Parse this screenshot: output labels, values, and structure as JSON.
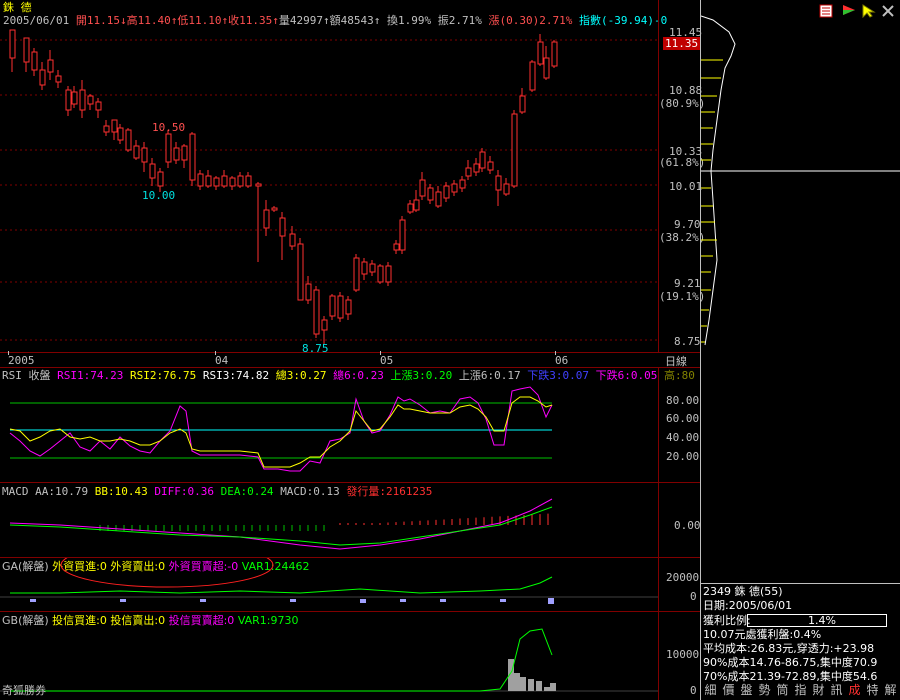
{
  "stock": {
    "name": "銖 德",
    "code_line": "2349 銖 德(55)"
  },
  "quote_bar": {
    "date": "2005/06/01",
    "open": "開11.15↓",
    "high": "高11.40↑",
    "low": "低11.10↑",
    "close": "收11.35↑",
    "volume": "量42997↑",
    "amount": "額48543↑",
    "turnover": "換1.99%",
    "amplitude": "振2.71%",
    "change": "漲(0.30)2.71%",
    "index": "指數(-39.94)-0"
  },
  "price_axis": {
    "ticks": [
      "11.45",
      "10.88",
      "(80.9%)",
      "10.33",
      "(61.8%)",
      "10.01",
      "9.70",
      "(38.2%)",
      "9.21",
      "(19.1%)",
      "8.75"
    ],
    "current_price": "11.35"
  },
  "annotations": {
    "high_label": "10.50",
    "low_label": "10.00",
    "bottom_label": "8.75"
  },
  "time_axis": {
    "labels": [
      "2005",
      "04",
      "05",
      "06"
    ],
    "period": "日線"
  },
  "rsi": {
    "label": "RSI 收盤",
    "rsi1": "RSI1:74.23",
    "rsi2": "RSI2:76.75",
    "rsi3": "RSI3:74.82",
    "total3": "總3:0.27",
    "total6": "總6:0.23",
    "up3": "上漲3:0.20",
    "up6": "上漲6:0.17",
    "down3": "下跌3:0.07",
    "down6": "下跌6:0.05",
    "hi": "高:80",
    "ticks": [
      "80.00",
      "60.00",
      "40.00",
      "20.00"
    ],
    "colors": {
      "rsi1": "#ff00ff",
      "rsi2": "#ffff00",
      "rsi3": "#ffffff"
    }
  },
  "macd": {
    "label": "MACD",
    "aa": "AA:10.79",
    "bb": "BB:10.43",
    "diff": "DIFF:0.36",
    "dea": "DEA:0.24",
    "macd": "MACD:0.13",
    "vol": "發行量:2161235",
    "ticks": [
      "0.00"
    ]
  },
  "ga": {
    "label": "GA(解盤)",
    "buy": "外資買進:0",
    "sell": "外資賣出:0",
    "net": "外資買賣超:-0",
    "var1": "VAR1:24462",
    "ticks": [
      "20000",
      "0"
    ]
  },
  "gb": {
    "label": "GB(解盤)",
    "buy": "投信買進:0",
    "sell": "投信賣出:0",
    "net": "投信買賣超:0",
    "var1": "VAR1:9730",
    "ticks": [
      "10000",
      "0"
    ]
  },
  "brand": "奇狐勝券",
  "info_panel": {
    "date": "日期:2005/06/01",
    "profit_ratio_label": "獲利比例:",
    "profit_ratio_value": "1.4%",
    "line1": "10.07元處獲利盤:0.4%",
    "line2": "平均成本:26.83元,穿透力:+23.98",
    "line3": "90%成本14.76-86.75,集中度70.9",
    "line4": "70%成本21.39-72.89,集中度54.6"
  },
  "bottom_tabs": [
    "細",
    "價",
    "盤",
    "勢",
    "筒",
    "指",
    "財",
    "訊",
    "成",
    "特",
    "解"
  ],
  "toolbar_icons": [
    "list-icon",
    "flag-icon",
    "arrow-cursor-icon",
    "tools-icon"
  ]
}
